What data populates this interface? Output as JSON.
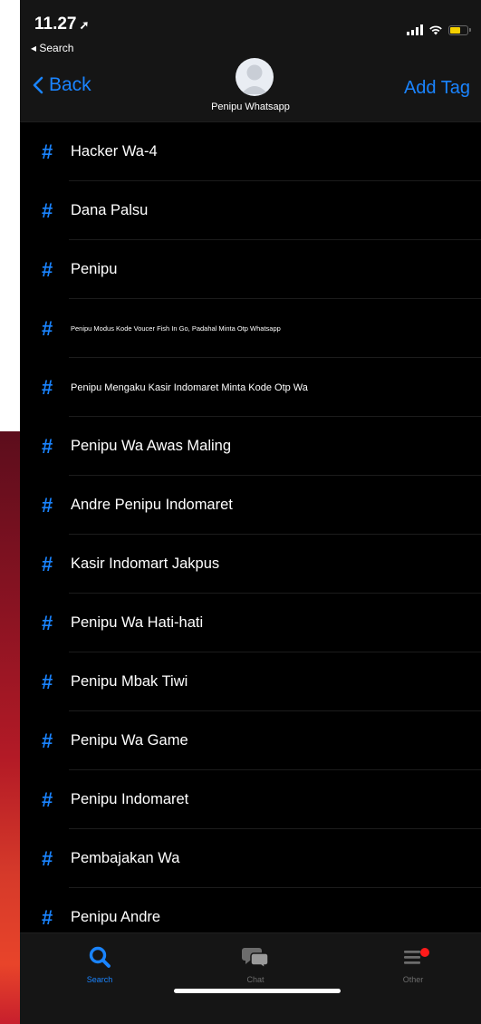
{
  "status": {
    "time": "11.27",
    "location_arrow": "➚",
    "back_label": "◂ Search"
  },
  "nav": {
    "back_label": "Back",
    "title": "Penipu Whatsapp",
    "add_tag_label": "Add Tag"
  },
  "tags": [
    {
      "label": "Hacker Wa-4"
    },
    {
      "label": "Dana Palsu"
    },
    {
      "label": "Penipu"
    },
    {
      "label": "Penipu Modus Kode Voucer Fish In Go, Padahal Minta Otp Whatsapp"
    },
    {
      "label": "Penipu Mengaku Kasir Indomaret Minta Kode Otp Wa"
    },
    {
      "label": "Penipu Wa Awas Maling"
    },
    {
      "label": "Andre Penipu Indomaret"
    },
    {
      "label": "Kasir Indomart Jakpus"
    },
    {
      "label": "Penipu Wa Hati-hati"
    },
    {
      "label": "Penipu Mbak Tiwi"
    },
    {
      "label": "Penipu Wa Game"
    },
    {
      "label": "Penipu Indomaret"
    },
    {
      "label": "Pembajakan Wa"
    },
    {
      "label": "Penipu Andre"
    }
  ],
  "tabs": {
    "search": {
      "label": "Search",
      "icon": "search-icon",
      "active": true
    },
    "chat": {
      "label": "Chat",
      "icon": "chat-icon",
      "active": false
    },
    "other": {
      "label": "Other",
      "icon": "menu-icon",
      "active": false,
      "badge": true
    }
  },
  "colors": {
    "accent": "#1a84ff",
    "background": "#000000",
    "bar": "#151515",
    "badge": "#ff1a1a"
  }
}
